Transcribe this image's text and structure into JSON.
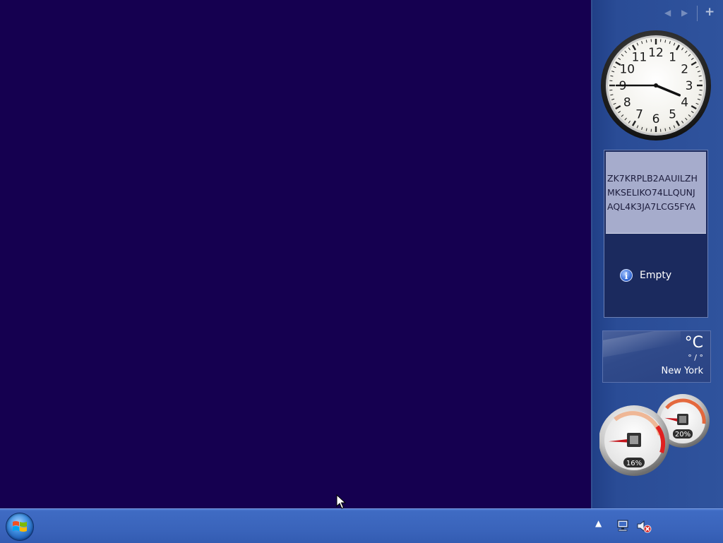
{
  "sidebar": {
    "prev_icon": "chevron-left-icon",
    "next_icon": "chevron-right-icon",
    "add_label": "+"
  },
  "clock": {
    "numbers": [
      "12",
      "1",
      "2",
      "3",
      "4",
      "5",
      "6",
      "7",
      "8",
      "9",
      "10",
      "11"
    ],
    "hour": 3,
    "minute": 45
  },
  "notes": {
    "text": "ZK7KRPLB2AAUILZH\nMKSELIKO74LLQUNJ\nAQL4K3JA7LCG5FYA",
    "status": "Empty",
    "status_icon": "info-icon"
  },
  "weather": {
    "temperature": "°C",
    "range": "° / °",
    "city": "New York"
  },
  "meter": {
    "cpu_label": "16%",
    "cpu_percent": 16,
    "memory_label": "20%",
    "memory_percent": 20
  },
  "taskbar": {
    "start_icon": "windows-logo-icon",
    "tray": [
      "show-hidden-icons-icon",
      "network-icon",
      "volume-muted-icon"
    ]
  },
  "colors": {
    "desktop": "#150050",
    "sidebar": "#2a4c96",
    "taskbar": "#3a64bb"
  }
}
